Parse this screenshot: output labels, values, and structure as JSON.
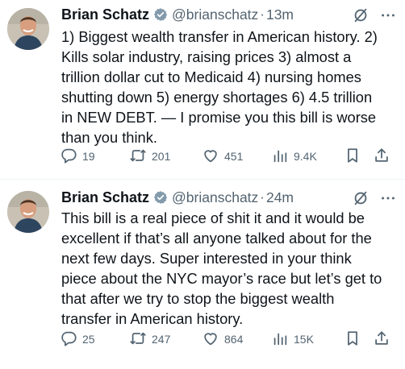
{
  "tweets": [
    {
      "author_name": "Brian Schatz",
      "handle": "@brianschatz",
      "separator": "·",
      "time": "13m",
      "text": "1) Biggest wealth transfer in American history. 2)\nKills solar industry, raising prices 3) almost a\ntrillion dollar cut to Medicaid 4) nursing homes\nshutting down 5) energy shortages 6) 4.5 trillion\nin NEW DEBT. — I promise you this bill is worse\nthan you think.",
      "replies": "19",
      "reposts": "201",
      "likes": "451",
      "views": "9.4K"
    },
    {
      "author_name": "Brian Schatz",
      "handle": "@brianschatz",
      "separator": "·",
      "time": "24m",
      "text": "This bill is a real piece of shit it and it would be\nexcellent if that’s all anyone talked about for the\nnext few days. Super interested in your think\npiece about the NYC mayor’s race but let’s get to\nthat after we try to stop the biggest wealth\ntransfer in American history.",
      "replies": "25",
      "reposts": "247",
      "likes": "864",
      "views": "15K"
    }
  ],
  "icons": {
    "verified": "verified-badge-icon",
    "grok": "grok-icon",
    "more": "more-icon",
    "reply": "reply-icon",
    "repost": "repost-icon",
    "like": "like-icon",
    "views": "views-icon",
    "bookmark": "bookmark-icon",
    "share": "share-icon"
  },
  "colors": {
    "text": "#0f1419",
    "secondary": "#536471",
    "verified_badge": "#829aab",
    "divider": "#eff3f4"
  }
}
